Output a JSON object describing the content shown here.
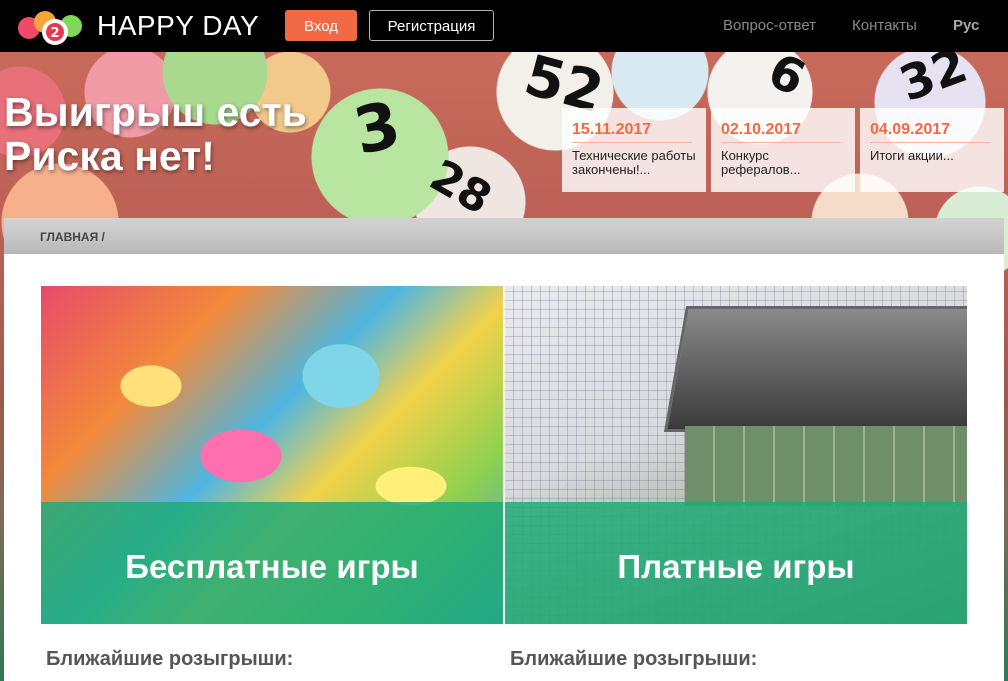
{
  "header": {
    "logo_text": "HAPPY DAY",
    "login_label": "Вход",
    "register_label": "Регистрация",
    "nav": [
      {
        "label": "Вопрос-ответ"
      },
      {
        "label": "Контакты"
      },
      {
        "label": "Рус"
      }
    ]
  },
  "hero": {
    "title_line1": "Выигрыш есть",
    "title_line2": "Риска нет!",
    "news": [
      {
        "date": "15.11.2017",
        "text": "Технические работы закончены!..."
      },
      {
        "date": "02.10.2017",
        "text": "Конкурс рефералов..."
      },
      {
        "date": "04.09.2017",
        "text": "Итоги акции..."
      }
    ]
  },
  "breadcrumb": {
    "home": "ГЛАВНАЯ /"
  },
  "tiles": {
    "free_label": "Бесплатные игры",
    "paid_label": "Платные игры"
  },
  "draws": {
    "left_title": "Ближайшие розыгрыши:",
    "right_title": "Ближайшие розыгрыши:"
  },
  "colors": {
    "accent": "#f26a45",
    "tile_overlay": "#20aa78",
    "topbar": "#000000"
  }
}
